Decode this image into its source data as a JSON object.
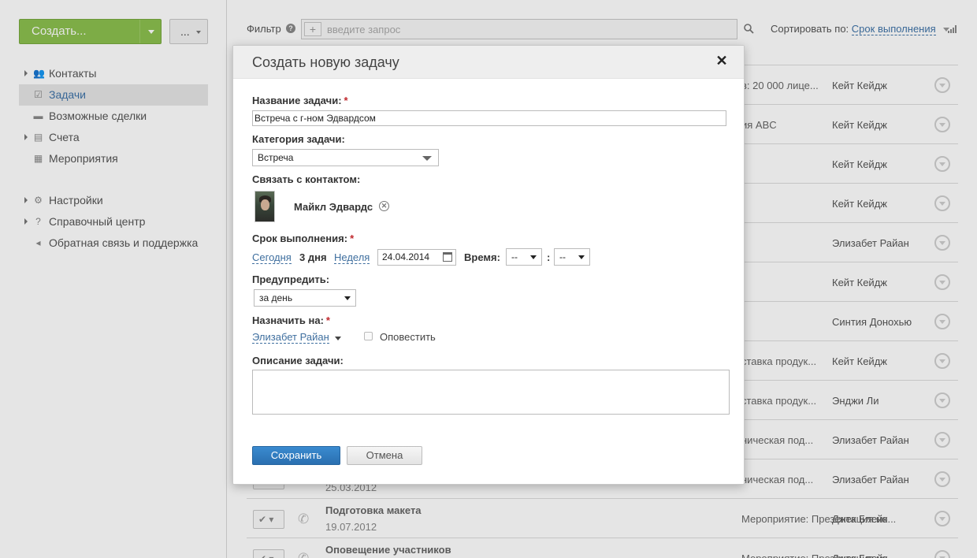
{
  "sidebar": {
    "create_label": "Создать...",
    "more_label": "...",
    "nav_main": [
      {
        "label": "Контакты",
        "icon": "contacts-icon",
        "arrow": true,
        "active": false
      },
      {
        "label": "Задачи",
        "icon": "tasks-icon",
        "arrow": false,
        "active": true
      },
      {
        "label": "Возможные сделки",
        "icon": "deals-icon",
        "arrow": false,
        "active": false
      },
      {
        "label": "Счета",
        "icon": "invoices-icon",
        "arrow": true,
        "active": false
      },
      {
        "label": "Мероприятия",
        "icon": "events-icon",
        "arrow": false,
        "active": false
      }
    ],
    "nav_secondary": [
      {
        "label": "Настройки",
        "icon": "gear-icon",
        "arrow": true
      },
      {
        "label": "Справочный центр",
        "icon": "help-icon",
        "arrow": true
      },
      {
        "label": "Обратная связь и поддержка",
        "icon": "megaphone-icon",
        "arrow": false
      }
    ]
  },
  "filter": {
    "label": "Фильтр",
    "placeholder": "введите запрос",
    "sort_label": "Сортировать по:",
    "sort_value": "Срок выполнения"
  },
  "tasks": [
    {
      "title": "",
      "date": "",
      "related": "в: 20 000 лице...",
      "owner": "Кейт Кейдж"
    },
    {
      "title": "",
      "date": "",
      "related": "ия ABC",
      "owner": "Кейт Кейдж"
    },
    {
      "title": "",
      "date": "",
      "related": "",
      "owner": "Кейт Кейдж"
    },
    {
      "title": "",
      "date": "",
      "related": "",
      "owner": "Кейт Кейдж"
    },
    {
      "title": "",
      "date": "",
      "related": "",
      "owner": "Элизабет Райан"
    },
    {
      "title": "",
      "date": "",
      "related": "",
      "owner": "Кейт Кейдж"
    },
    {
      "title": "",
      "date": "",
      "related": "",
      "owner": "Синтия Донохью"
    },
    {
      "title": "",
      "date": "",
      "related": "ставка продук...",
      "owner": "Кейт Кейдж"
    },
    {
      "title": "",
      "date": "",
      "related": "ставка продук...",
      "owner": "Энджи Ли"
    },
    {
      "title": "",
      "date": "",
      "related": "ническая под...",
      "owner": "Элизабет Райан"
    },
    {
      "title": "",
      "date": "25.03.2012",
      "related": "ническая под...",
      "owner": "Элизабет Райан"
    },
    {
      "title": "Подготовка макета",
      "date": "19.07.2012",
      "related": "Мероприятие: Презентация но...",
      "owner": "Джек Блейк"
    },
    {
      "title": "Оповещение участников",
      "date": "",
      "related": "Мероприятие: Презентация но...",
      "owner": "Джек Блейк"
    }
  ],
  "modal": {
    "title": "Создать новую задачу",
    "close_icon": "close-icon",
    "name_label": "Название задачи:",
    "name_value": "Встреча с г-ном Эдвардсом",
    "category_label": "Категория задачи:",
    "category_value": "Встреча",
    "contact_label": "Связать с контактом:",
    "contact_name": "Майкл Эдвардс",
    "due_label": "Срок выполнения:",
    "due_today": "Сегодня",
    "due_3days": "3 дня",
    "due_week": "Неделя",
    "due_date": "24.04.2014",
    "time_label": "Время:",
    "time_hour": "--",
    "time_sep": ":",
    "time_min": "--",
    "remind_label": "Предупредить:",
    "remind_value": "за день",
    "assign_label": "Назначить на:",
    "assign_value": "Элизабет Райан",
    "notify_label": "Оповестить",
    "notify_checked": false,
    "desc_label": "Описание задачи:",
    "desc_value": "",
    "save_label": "Сохранить",
    "cancel_label": "Отмена",
    "required_mark": "*"
  },
  "colors": {
    "create_green": "#8cc04f",
    "link_blue": "#3f73a8",
    "save_blue": "#2a6fb0",
    "required_red": "#c0282d"
  }
}
